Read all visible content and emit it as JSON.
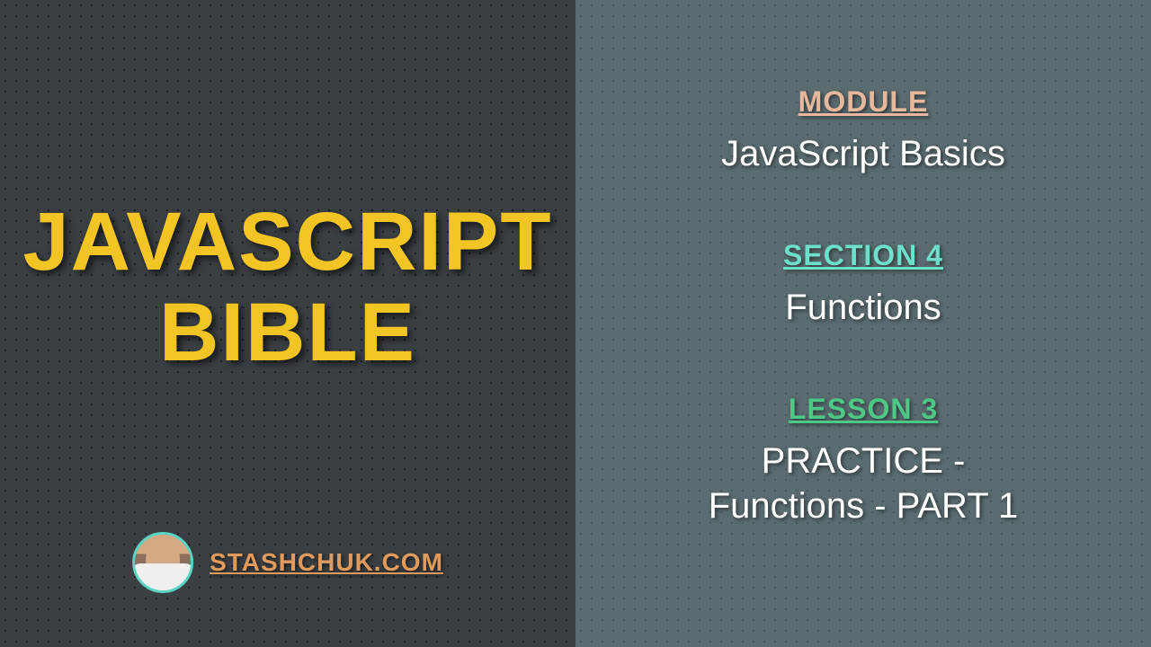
{
  "title_line1": "JAVASCRIPT",
  "title_line2": "BIBLE",
  "author_url": "STASHCHUK.COM",
  "module_label": "MODULE",
  "module_value": "JavaScript Basics",
  "section_label": "SECTION 4",
  "section_value": "Functions",
  "lesson_label": "LESSON 3",
  "lesson_value_line1": "PRACTICE -",
  "lesson_value_line2": "Functions - PART 1"
}
